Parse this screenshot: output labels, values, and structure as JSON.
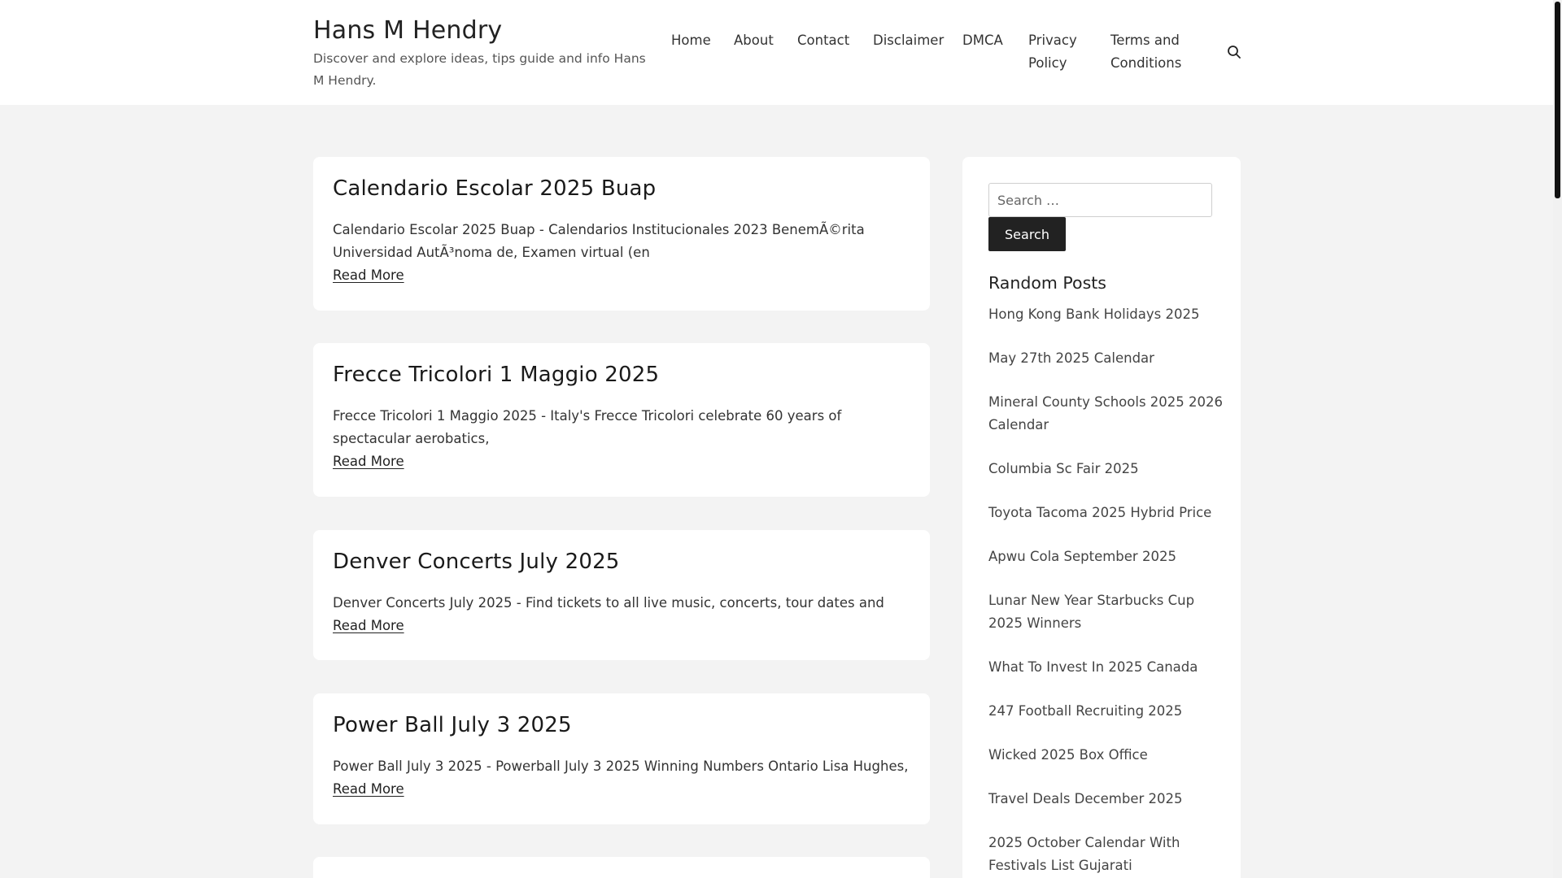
{
  "header": {
    "site_title": "Hans M Hendry",
    "site_description": "Discover and explore ideas, tips guide and info Hans M Hendry.",
    "nav": {
      "home": "Home",
      "about": "About",
      "contact": "Contact",
      "disclaimer": "Disclaimer",
      "dmca": "DMCA",
      "privacy": "Privacy Policy",
      "terms": "Terms and Conditions"
    }
  },
  "posts": [
    {
      "title": "Calendario Escolar 2025 Buap",
      "excerpt": "Calendario Escolar 2025 Buap - Calendarios Institucionales 2023 BenemÃ©rita Universidad AutÃ³noma de, Examen virtual (en",
      "read_more": "Read More"
    },
    {
      "title": "Frecce Tricolori 1 Maggio 2025",
      "excerpt": "Frecce Tricolori 1 Maggio 2025 - Italy's Frecce Tricolori celebrate 60 years of spectacular aerobatics,",
      "read_more": "Read More"
    },
    {
      "title": "Denver Concerts July 2025",
      "excerpt": "Denver Concerts July 2025 - Find tickets to all live music, concerts, tour dates and",
      "read_more": "Read More"
    },
    {
      "title": "Power Ball July 3 2025",
      "excerpt": "Power Ball July 3 2025 - Powerball July 3 2025 Winning Numbers Ontario Lisa Hughes,",
      "read_more": "Read More"
    }
  ],
  "sidebar": {
    "search_placeholder": "Search …",
    "search_button": "Search",
    "widget_title": "Random Posts",
    "random_posts": [
      "Hong Kong Bank Holidays 2025",
      "May 27th 2025 Calendar",
      "Mineral County Schools 2025 2026 Calendar",
      "Columbia Sc Fair 2025",
      "Toyota Tacoma 2025 Hybrid Price",
      "Apwu Cola September 2025",
      "Lunar New Year Starbucks Cup 2025 Winners",
      "What To Invest In 2025 Canada",
      "247 Football Recruiting 2025",
      "Wicked 2025 Box Office",
      "Travel Deals December 2025",
      "2025 October Calendar With Festivals List Gujarati"
    ]
  }
}
